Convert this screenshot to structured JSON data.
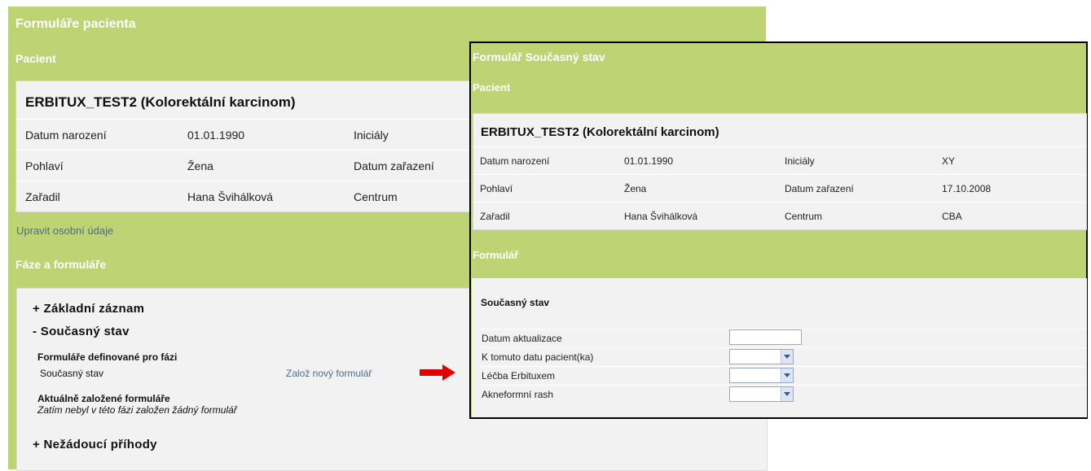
{
  "back": {
    "title": "Formuláře pacienta",
    "patient_section": "Pacient",
    "patient_name": "ERBITUX_TEST2 (Kolorektální karcinom)",
    "rows": [
      [
        "Datum narození",
        "01.01.1990",
        "Iniciály"
      ],
      [
        "Pohlaví",
        "Žena",
        "Datum zařazení"
      ],
      [
        "Zařadil",
        "Hana Švihálková",
        "Centrum"
      ]
    ],
    "edit_link": "Upravit osobní údaje",
    "phases_section": "Fáze a formuláře",
    "phases": {
      "basic": "+  Základní záznam",
      "current": "-  Současný stav",
      "defined_heading": "Formuláře definované pro fázi",
      "defined_item": "Současný stav",
      "new_form_link": "Založ nový formulář",
      "created_heading": "Aktuálně založené formuláře",
      "created_empty": "Zatím nebyl v této fázi založen žádný formulář",
      "adverse": "+  Nežádoucí příhody"
    }
  },
  "arrow_color": "#e00000",
  "front": {
    "title": "Formulář Současný stav",
    "patient_section": "Pacient",
    "patient_name": "ERBITUX_TEST2 (Kolorektální karcinom)",
    "rows": [
      [
        "Datum narození",
        "01.01.1990",
        "Iniciály",
        "XY"
      ],
      [
        "Pohlaví",
        "Žena",
        "Datum zařazení",
        "17.10.2008"
      ],
      [
        "Zařadil",
        "Hana Švihálková",
        "Centrum",
        "CBA"
      ]
    ],
    "form_section": "Formulář",
    "form_heading": "Současný stav",
    "fields": [
      {
        "label": "Datum aktualizace",
        "type": "text",
        "value": ""
      },
      {
        "label": "K tomuto datu pacient(ka)",
        "type": "select",
        "value": ""
      },
      {
        "label": "Léčba Erbituxem",
        "type": "select",
        "value": ""
      },
      {
        "label": "Akneformní rash",
        "type": "select",
        "value": ""
      }
    ]
  }
}
